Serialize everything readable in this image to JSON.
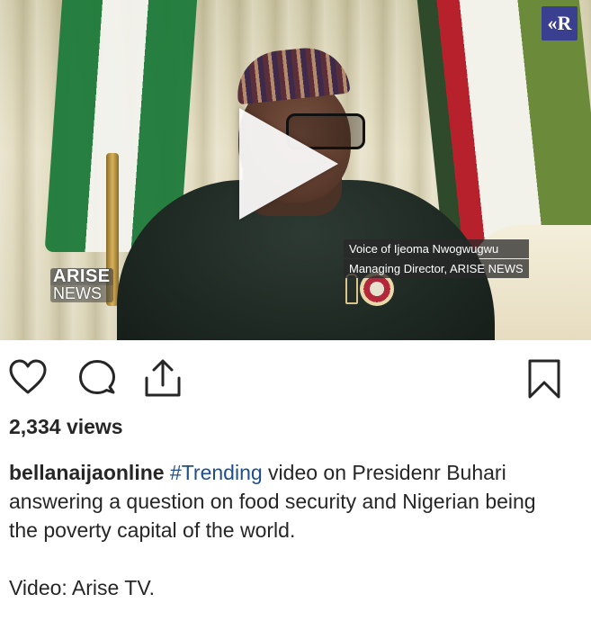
{
  "video": {
    "watermark_text": "ARISE",
    "watermark_text_2": "NEWS",
    "corner_logo": "«R",
    "lower_third_line1": "Voice of Ijeoma Nwogwugwu",
    "lower_third_line2": "Managing Director, ARISE NEWS",
    "play_icon": "play-icon"
  },
  "actions": {
    "like_icon": "heart-icon",
    "comment_icon": "comment-icon",
    "share_icon": "share-icon",
    "save_icon": "bookmark-icon"
  },
  "post": {
    "views": "2,334 views",
    "username": "bellanaijaonline",
    "hashtag": "#Trending",
    "caption_text": " video on Presidenr Buhari answering a question on food security and Nigerian being the poverty capital of the world.",
    "credit": "Video: Arise TV."
  },
  "colors": {
    "text": "#262626",
    "hashtag": "#1f4e8c",
    "logo_bg": "#3b3f8f"
  }
}
